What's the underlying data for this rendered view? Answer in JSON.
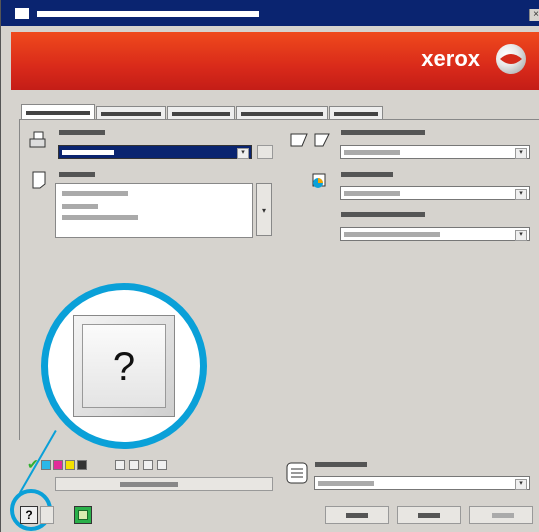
{
  "brand": {
    "name": "xerox"
  },
  "icons": {
    "window_close": "×",
    "help": "?",
    "combo_arrow": "▾",
    "check": "✔"
  },
  "colors": {
    "titlebar": "#0a2470",
    "banner": "#e8381b",
    "callout": "#0aa0d8",
    "selected_field": "#0a2470",
    "check_green": "#30b030"
  }
}
